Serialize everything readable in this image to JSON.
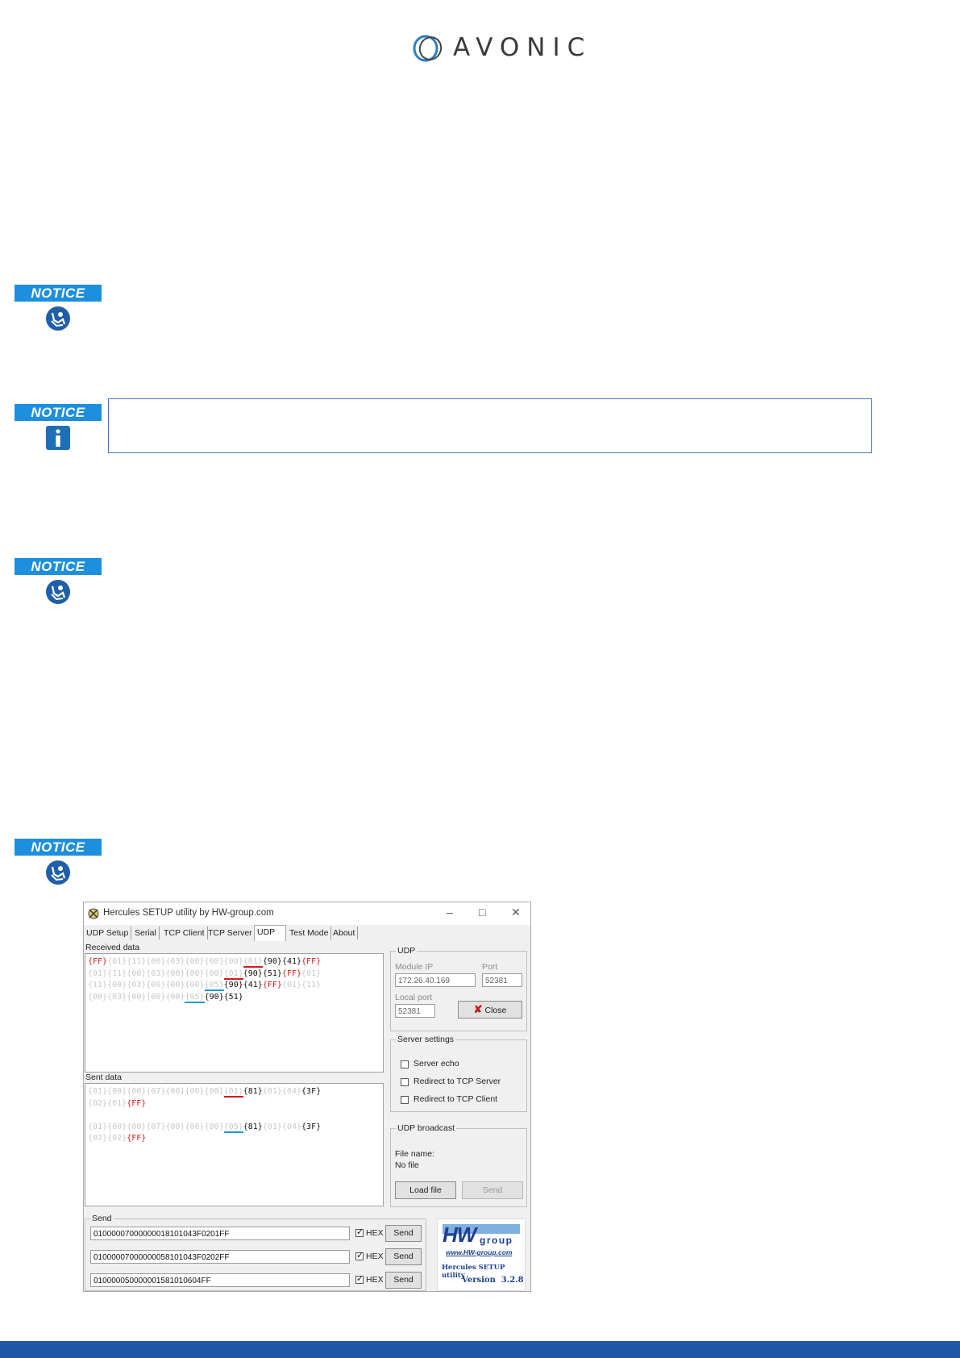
{
  "logo": {
    "word": "AVONIC"
  },
  "notices": [
    {
      "label": "NOTICE",
      "icon": "person-reading-icon"
    },
    {
      "label": "NOTICE",
      "icon": "info-icon"
    },
    {
      "label": "NOTICE",
      "icon": "person-reading-icon"
    },
    {
      "label": "NOTICE",
      "icon": "person-reading-icon"
    }
  ],
  "app": {
    "title": "Hercules SETUP utility by HW-group.com",
    "tabs": [
      "UDP Setup",
      "Serial",
      "TCP Client",
      "TCP Server",
      "UDP",
      "Test Mode",
      "About"
    ],
    "active_tab": "UDP",
    "received_label": "Received data",
    "sent_label": "Sent data",
    "udp": {
      "legend": "UDP",
      "module_ip_label": "Module IP",
      "module_ip": "172.26.40.169",
      "port_label": "Port",
      "port": "52381",
      "local_port_label": "Local port",
      "local_port": "52381",
      "close_label": "Close"
    },
    "server_settings": {
      "legend": "Server settings",
      "options": [
        "Server echo",
        "Redirect to TCP Server",
        "Redirect to TCP Client"
      ]
    },
    "udp_broadcast": {
      "legend": "UDP broadcast",
      "file_name_label": "File name:",
      "file_name": "No file",
      "load_label": "Load file",
      "send_label": "Send"
    },
    "send": {
      "legend": "Send",
      "rows": [
        {
          "value": "01000007000000018101043F0201FF",
          "hex_label": "HEX",
          "button": "Send"
        },
        {
          "value": "01000007000000058101043F0202FF",
          "hex_label": "HEX",
          "button": "Send"
        },
        {
          "value": "010000050000001581010604FF",
          "hex_label": "HEX",
          "button": "Send"
        }
      ]
    },
    "hw_logo": {
      "brand": "HW",
      "group": "group",
      "url": "www.HW-group.com",
      "product": "Hercules SETUP utility",
      "version": "Version  3.2.8"
    },
    "received_tokens": [
      {
        "t": "{FF}",
        "c": "r"
      },
      {
        "t": "{01}",
        "c": "g"
      },
      {
        "t": "{11}",
        "c": "g"
      },
      {
        "t": "{00}",
        "c": "g"
      },
      {
        "t": "{03}",
        "c": "g"
      },
      {
        "t": "{00}",
        "c": "g"
      },
      {
        "t": "{00}",
        "c": "g"
      },
      {
        "t": "{00}",
        "c": "g"
      },
      {
        "t": "{01}",
        "c": "g",
        "u": "r"
      },
      {
        "t": "{90}",
        "c": "k"
      },
      {
        "t": "{41}",
        "c": "k"
      },
      {
        "t": "{FF}",
        "c": "r"
      },
      {
        "br": true
      },
      {
        "t": "{01}",
        "c": "g"
      },
      {
        "t": "{11}",
        "c": "g"
      },
      {
        "t": "{00}",
        "c": "g"
      },
      {
        "t": "{03}",
        "c": "g"
      },
      {
        "t": "{00}",
        "c": "g"
      },
      {
        "t": "{00}",
        "c": "g"
      },
      {
        "t": "{00}",
        "c": "g"
      },
      {
        "t": "{01}",
        "c": "g",
        "u": "r"
      },
      {
        "t": "{90}",
        "c": "k"
      },
      {
        "t": "{51}",
        "c": "k"
      },
      {
        "t": "{FF}",
        "c": "r"
      },
      {
        "t": "{01}",
        "c": "g"
      },
      {
        "br": true
      },
      {
        "t": "{11}",
        "c": "g"
      },
      {
        "t": "{00}",
        "c": "g"
      },
      {
        "t": "{03}",
        "c": "g"
      },
      {
        "t": "{00}",
        "c": "g"
      },
      {
        "t": "{00}",
        "c": "g"
      },
      {
        "t": "{00}",
        "c": "g"
      },
      {
        "t": "{05}",
        "c": "g",
        "u": "b"
      },
      {
        "t": "{90}",
        "c": "k"
      },
      {
        "t": "{41}",
        "c": "k"
      },
      {
        "t": "{FF}",
        "c": "r"
      },
      {
        "t": "{01}",
        "c": "g"
      },
      {
        "t": "{11}",
        "c": "g"
      },
      {
        "br": true
      },
      {
        "t": "{00}",
        "c": "g"
      },
      {
        "t": "{03}",
        "c": "g"
      },
      {
        "t": "{00}",
        "c": "g"
      },
      {
        "t": "{00}",
        "c": "g"
      },
      {
        "t": "{00}",
        "c": "g"
      },
      {
        "t": "{05}",
        "c": "g",
        "u": "b"
      },
      {
        "t": "{90}",
        "c": "k"
      },
      {
        "t": "{51}",
        "c": "k"
      }
    ],
    "sent_tokens": [
      {
        "t": "{01}",
        "c": "g"
      },
      {
        "t": "{00}",
        "c": "g"
      },
      {
        "t": "{00}",
        "c": "g"
      },
      {
        "t": "{07}",
        "c": "g"
      },
      {
        "t": "{00}",
        "c": "g"
      },
      {
        "t": "{00}",
        "c": "g"
      },
      {
        "t": "{00}",
        "c": "g"
      },
      {
        "t": "{01}",
        "c": "g",
        "u": "r"
      },
      {
        "t": "{81}",
        "c": "k"
      },
      {
        "t": "{01}",
        "c": "g"
      },
      {
        "t": "{04}",
        "c": "g"
      },
      {
        "t": "{3F}",
        "c": "k"
      },
      {
        "br": true
      },
      {
        "t": "{02}",
        "c": "g"
      },
      {
        "t": "{01}",
        "c": "g"
      },
      {
        "t": "{FF}",
        "c": "r"
      },
      {
        "br": true
      },
      {
        "br": true
      },
      {
        "t": "{01}",
        "c": "g"
      },
      {
        "t": "{00}",
        "c": "g"
      },
      {
        "t": "{00}",
        "c": "g"
      },
      {
        "t": "{07}",
        "c": "g"
      },
      {
        "t": "{00}",
        "c": "g"
      },
      {
        "t": "{00}",
        "c": "g"
      },
      {
        "t": "{00}",
        "c": "g"
      },
      {
        "t": "{05}",
        "c": "g",
        "u": "b"
      },
      {
        "t": "{81}",
        "c": "k"
      },
      {
        "t": "{01}",
        "c": "g"
      },
      {
        "t": "{04}",
        "c": "g"
      },
      {
        "t": "{3F}",
        "c": "k"
      },
      {
        "br": true
      },
      {
        "t": "{02}",
        "c": "g"
      },
      {
        "t": "{02}",
        "c": "g"
      },
      {
        "t": "{FF}",
        "c": "r"
      }
    ]
  }
}
